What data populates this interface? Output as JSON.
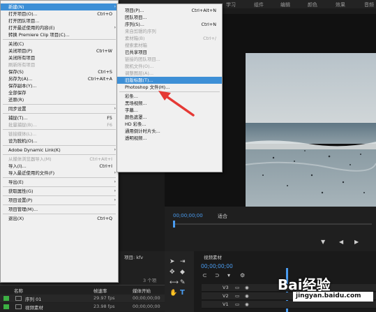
{
  "workspace_tabs": [
    "学习",
    "组件",
    "编辑",
    "颜色",
    "效果",
    "音频"
  ],
  "file_menu": {
    "items": [
      {
        "label": "新建(N)",
        "submenu": true,
        "highlighted": true
      },
      {
        "label": "打开项目(O)...",
        "shortcut": "Ctrl+O"
      },
      {
        "label": "打开团队项目..."
      },
      {
        "label": "打开最近使用的内容(E)",
        "submenu": true
      },
      {
        "label": "转换 Premiere Clip 项目(C)..."
      },
      {
        "separator": true
      },
      {
        "label": "关闭(C)"
      },
      {
        "label": "关闭项目(P)",
        "shortcut": "Ctrl+W"
      },
      {
        "label": "关闭所有项目"
      },
      {
        "label": "刷新所有项目",
        "disabled": true
      },
      {
        "label": "保存(S)",
        "shortcut": "Ctrl+S"
      },
      {
        "label": "另存为(A)...",
        "shortcut": "Ctrl+Alt+A"
      },
      {
        "label": "保存副本(Y)..."
      },
      {
        "label": "全部保存"
      },
      {
        "label": "还原(R)"
      },
      {
        "separator": true
      },
      {
        "label": "同步设置",
        "submenu": true
      },
      {
        "separator": true
      },
      {
        "label": "捕捉(T)...",
        "shortcut": "F5"
      },
      {
        "label": "批量捕捉(B)...",
        "shortcut": "F6",
        "disabled": true
      },
      {
        "separator": true
      },
      {
        "label": "链接媒体(L)...",
        "disabled": true
      },
      {
        "label": "设为脱机(O)..."
      },
      {
        "separator": true
      },
      {
        "label": "Adobe Dynamic Link(K)",
        "submenu": true
      },
      {
        "separator": true
      },
      {
        "label": "从媒体浏览器导入(M)",
        "shortcut": "Ctrl+Alt+I",
        "disabled": true
      },
      {
        "label": "导入(I)...",
        "shortcut": "Ctrl+I"
      },
      {
        "label": "导入最近使用的文件(F)",
        "submenu": true
      },
      {
        "separator": true
      },
      {
        "label": "导出(E)",
        "submenu": true
      },
      {
        "separator": true
      },
      {
        "label": "获取属性(G)",
        "submenu": true
      },
      {
        "separator": true
      },
      {
        "label": "项目设置(P)",
        "submenu": true
      },
      {
        "separator": true
      },
      {
        "label": "项目管理(M)..."
      },
      {
        "separator": true
      },
      {
        "label": "退出(X)",
        "shortcut": "Ctrl+Q"
      }
    ]
  },
  "new_submenu": {
    "items": [
      {
        "label": "项目(P)...",
        "shortcut": "Ctrl+Alt+N"
      },
      {
        "label": "团队项目..."
      },
      {
        "label": "序列(S)...",
        "shortcut": "Ctrl+N"
      },
      {
        "label": "来自剪辑的序列",
        "disabled": true
      },
      {
        "label": "素材箱(B)",
        "shortcut": "Ctrl+/",
        "disabled": true
      },
      {
        "label": "搜索素材箱",
        "disabled": true
      },
      {
        "label": "已共享项目"
      },
      {
        "label": "链接的团队项目...",
        "disabled": true
      },
      {
        "label": "脱机文件(O)...",
        "disabled": true
      },
      {
        "label": "调整图层(A)...",
        "disabled": true
      },
      {
        "label": "旧版标题(T)...",
        "highlighted": true
      },
      {
        "label": "Photoshop 文件(H)..."
      },
      {
        "separator": true
      },
      {
        "label": "彩条..."
      },
      {
        "label": "黑场视频..."
      },
      {
        "label": "字幕..."
      },
      {
        "label": "颜色遮罩..."
      },
      {
        "label": "HD 彩条..."
      },
      {
        "label": "通用倒计时片头..."
      },
      {
        "label": "透明视频..."
      }
    ]
  },
  "program_monitor": {
    "timecode": "00;00;00;00",
    "fit": "适合"
  },
  "project_panel": {
    "tab_label": "项目: kfv",
    "item_count": "3 个项",
    "columns": [
      "名称",
      "帧速率",
      "媒体开始"
    ],
    "rows": [
      {
        "name": "序列 01",
        "fps": "29.97 fps",
        "start": "00;00;00;00",
        "color": "#3cb043"
      },
      {
        "name": "视频素材",
        "fps": "23.98 fps",
        "start": "00;00;00;00",
        "color": "#3cb043"
      }
    ]
  },
  "timeline": {
    "tab_label": "视频素材",
    "timecode": "00;00;00;00",
    "tracks": [
      "V3",
      "V2",
      "V1"
    ]
  },
  "watermark": {
    "brand": "Bai经验",
    "url": "jingyan.baidu.com"
  },
  "colors": {
    "menu_highlight": "#3d8fd6",
    "timecode_blue": "#4a9cf0",
    "arrow_red": "#e53935"
  }
}
